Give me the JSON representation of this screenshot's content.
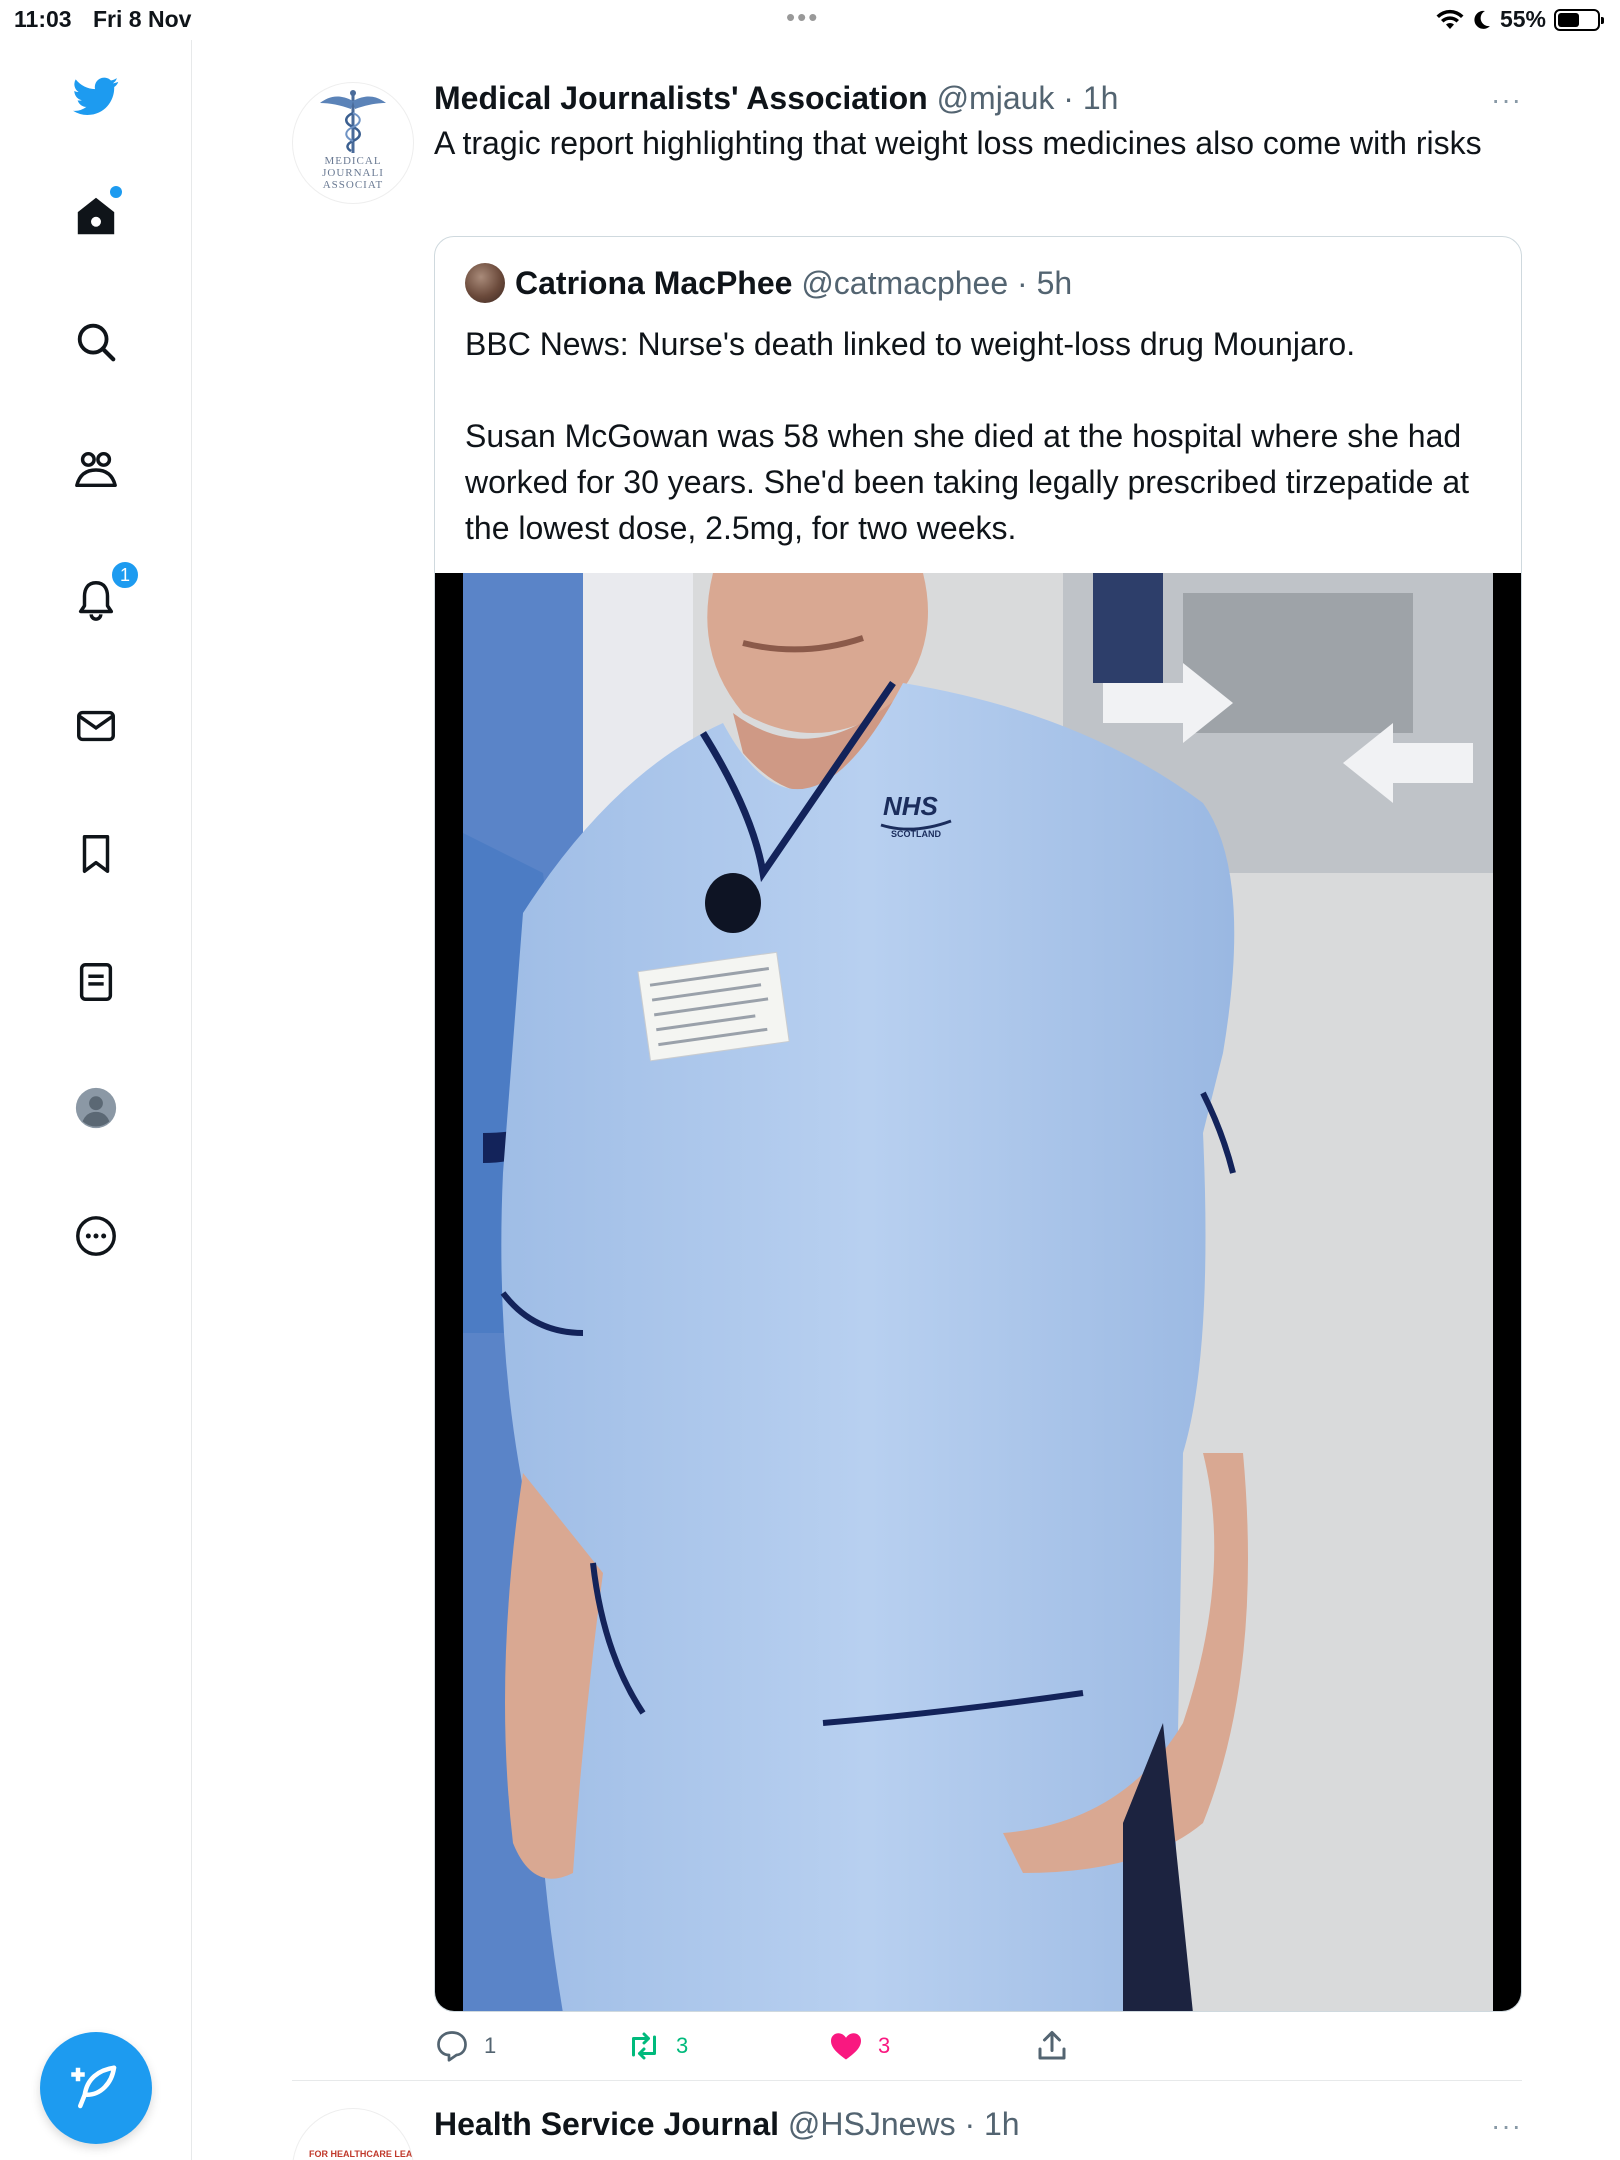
{
  "status_bar": {
    "time": "11:03",
    "date": "Fri 8 Nov",
    "battery": "55%",
    "battery_level": 0.55
  },
  "nav": {
    "items": [
      {
        "name": "twitter-logo",
        "icon": "twitter-bird"
      },
      {
        "name": "home",
        "icon": "home",
        "has_dot": true
      },
      {
        "name": "search",
        "icon": "search"
      },
      {
        "name": "communities",
        "icon": "people"
      },
      {
        "name": "notifications",
        "icon": "bell",
        "badge": "1"
      },
      {
        "name": "messages",
        "icon": "envelope"
      },
      {
        "name": "bookmarks",
        "icon": "bookmark"
      },
      {
        "name": "lists",
        "icon": "list"
      },
      {
        "name": "profile",
        "icon": "avatar"
      },
      {
        "name": "more",
        "icon": "more-circle"
      }
    ],
    "compose": {
      "icon": "feather-plus"
    }
  },
  "colors": {
    "accent": "#1d9bf0",
    "retweet": "#00ba7c",
    "like": "#f91880",
    "secondary_text": "#536471"
  },
  "tweet": {
    "author": "Medical Journalists' Association",
    "handle": "@mjauk",
    "time": "1h",
    "meta": "@mjauk · 1h",
    "text": "A tragic report highlighting that weight loss medicines also come with risks",
    "avatar_text": [
      "MEDICAL",
      "JOURNALI",
      "ASSOCIAT"
    ],
    "quote": {
      "author": "Catriona MacPhee",
      "meta": "@catmacphee · 5h",
      "paragraphs": [
        "BBC News: Nurse's death linked to weight-loss drug Mounjaro.",
        "Susan McGowan was 58 when she died at the hospital where she had worked for 30 years. She'd been taking legally prescribed tirzepatide at the lowest dose, 2.5mg, for two weeks."
      ],
      "image_labels": {
        "logo": "NHS",
        "sub": "SCOTLAND"
      }
    },
    "actions": {
      "replies": "1",
      "retweets": "3",
      "likes": "3"
    }
  },
  "next_tweet": {
    "author": "Health Service Journal",
    "meta": "@HSJnews · 1h",
    "avatar_text": "FOR HEALTHCARE LEADERS"
  },
  "more_label": "···",
  "status_dots": "•••"
}
